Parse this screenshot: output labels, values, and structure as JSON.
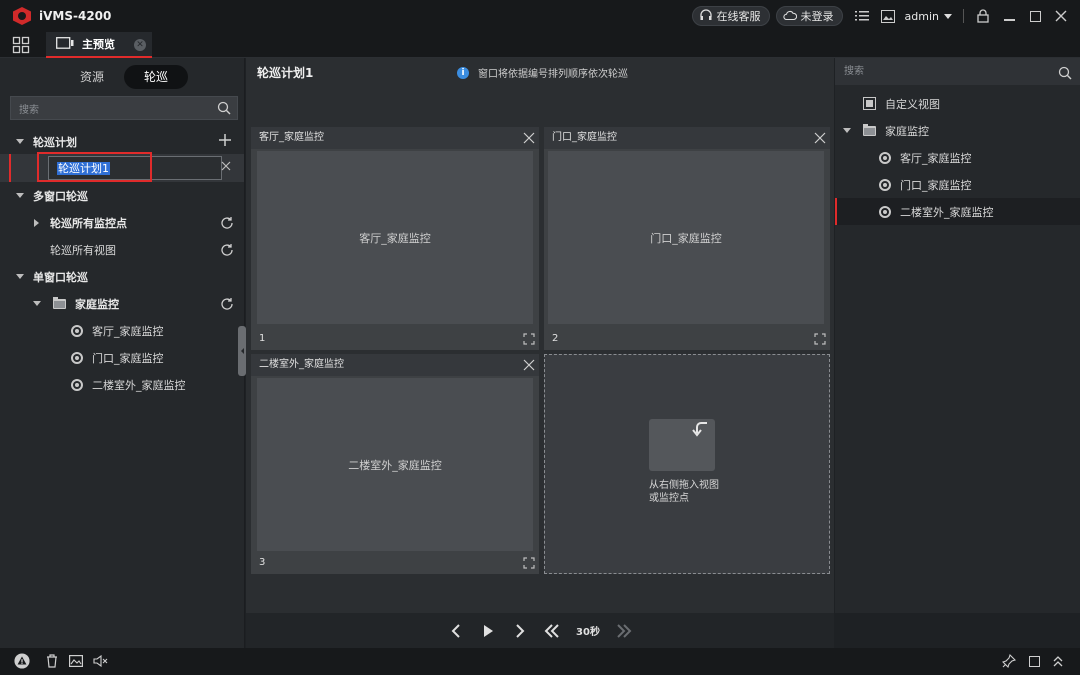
{
  "app": {
    "title": "iVMS-4200"
  },
  "titlebar": {
    "online_service": "在线客服",
    "login_status": "未登录",
    "username": "admin"
  },
  "tabs": [
    {
      "label": "主预览"
    }
  ],
  "left_panel": {
    "segments": [
      {
        "label": "资源"
      },
      {
        "label": "轮巡",
        "active": true
      }
    ],
    "search_placeholder": "搜索",
    "tree": {
      "patrol_plan_header": "轮巡计划",
      "editing_value": "轮巡计划1",
      "multi_window_header": "多窗口轮巡",
      "all_cameras": "轮巡所有监控点",
      "all_views": "轮巡所有视图",
      "single_window_header": "单窗口轮巡",
      "folder": "家庭监控",
      "cameras": [
        "客厅_家庭监控",
        "门口_家庭监控",
        "二楼室外_家庭监控"
      ]
    }
  },
  "center": {
    "plan_title": "轮巡计划1",
    "info_text": "窗口将依据编号排列顺序依次轮巡",
    "views": [
      {
        "header": "客厅_家庭监控",
        "body": "客厅_家庭监控",
        "number": "1"
      },
      {
        "header": "门口_家庭监控",
        "body": "门口_家庭监控",
        "number": "2"
      },
      {
        "header": "二楼室外_家庭监控",
        "body": "二楼室外_家庭监控",
        "number": "3"
      }
    ],
    "drop_hint_line1": "从右侧拖入视图",
    "drop_hint_line2": "或监控点",
    "interval": "30秒"
  },
  "right_panel": {
    "search_placeholder": "搜索",
    "custom_view": "自定义视图",
    "folder": "家庭监控",
    "cameras": [
      "客厅_家庭监控",
      "门口_家庭监控",
      "二楼室外_家庭监控"
    ]
  },
  "colors": {
    "accent": "#e02b2b",
    "info": "#3b8de0",
    "selection": "#2f6fd6"
  }
}
